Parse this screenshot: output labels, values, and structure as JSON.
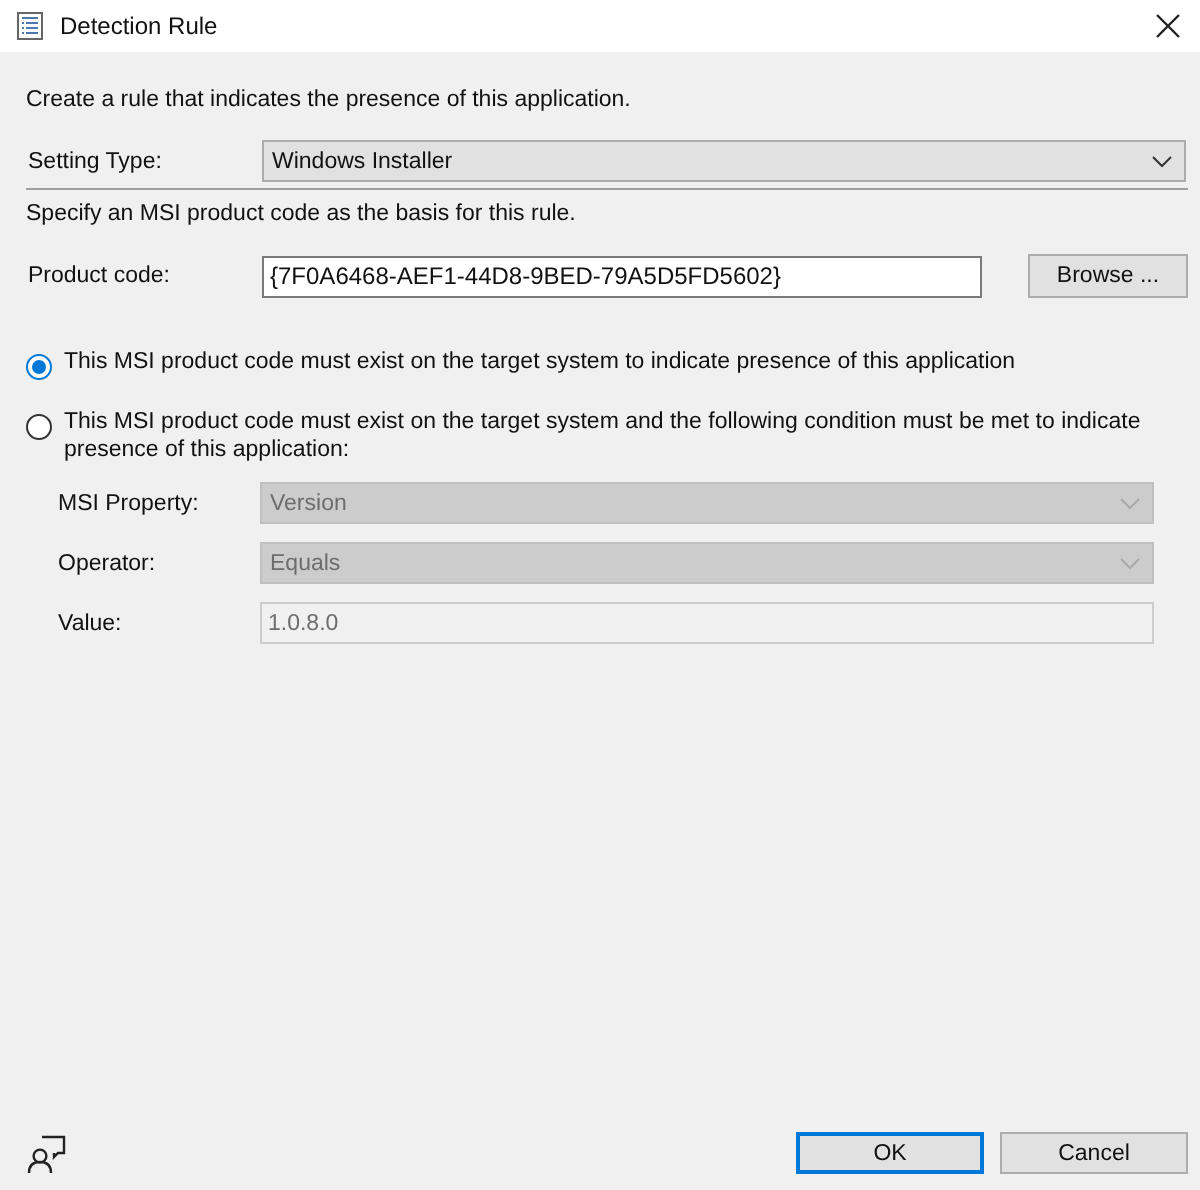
{
  "window": {
    "title": "Detection Rule"
  },
  "intro": "Create a rule that indicates the presence of this application.",
  "setting_type": {
    "label": "Setting Type:",
    "value": "Windows Installer"
  },
  "specify_text": "Specify an MSI product code as the basis for this rule.",
  "product_code": {
    "label": "Product code:",
    "value": "{7F0A6468-AEF1-44D8-9BED-79A5D5FD5602}"
  },
  "browse_button": "Browse ...",
  "options": [
    {
      "label": "This MSI product code must exist on the target system to indicate presence of this application",
      "selected": true
    },
    {
      "label": "This MSI product code must exist on the target system and the following condition must be met to indicate presence of this application:",
      "selected": false
    }
  ],
  "condition_fields": [
    {
      "kind": "dropdown",
      "label": "MSI Property:",
      "value": "Version",
      "disabled": true
    },
    {
      "kind": "dropdown",
      "label": "Operator:",
      "value": "Equals",
      "disabled": true
    },
    {
      "kind": "text",
      "label": "Value:",
      "value": "1.0.8.0",
      "disabled": true
    }
  ],
  "buttons": [
    {
      "label": "OK",
      "default": true
    },
    {
      "label": "Cancel",
      "default": false
    }
  ]
}
